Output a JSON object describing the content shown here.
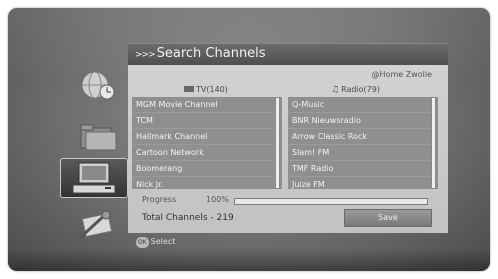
{
  "header": {
    "title": "Search Channels",
    "location": "@Home Zwolle"
  },
  "sidebar": {
    "icons": [
      "globe-clock-icon",
      "folder-icon",
      "tv-settop-icon",
      "tools-icon"
    ],
    "selected_index": 2
  },
  "tv": {
    "label": "TV(140)",
    "channels": [
      "MGM Movie Channel",
      "TCM",
      "Hallmark Channel",
      "Cartoon Network",
      "Boomerang",
      "Nick Jr."
    ]
  },
  "radio": {
    "label": "Radio(79)",
    "channels": [
      "Q-Music",
      "BNR Nieuwsradio",
      "Arrow Classic Rock",
      "Slam! FM",
      "TMF Radio",
      "Juize FM"
    ]
  },
  "progress": {
    "label": "Progress",
    "value_text": "100%",
    "fraction": 1.0
  },
  "total": "Total Channels - 219",
  "buttons": {
    "save": "Save"
  },
  "footer": {
    "ok_key": "OK",
    "hint": "Select"
  }
}
